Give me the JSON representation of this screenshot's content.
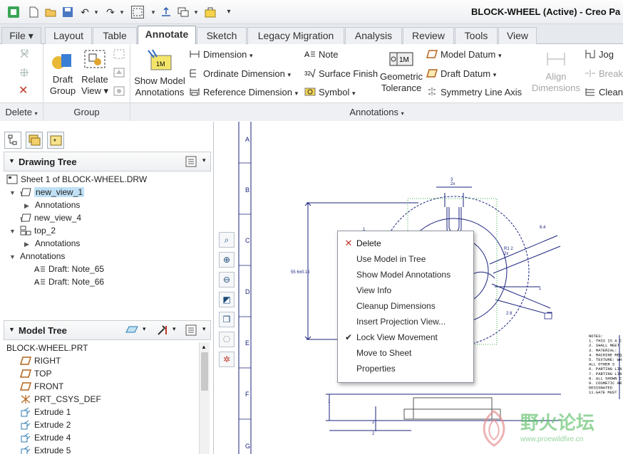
{
  "window": {
    "title": "BLOCK-WHEEL (Active) - Creo Pa"
  },
  "quick_access": [
    {
      "name": "app-logo-icon"
    },
    {
      "name": "new-icon"
    },
    {
      "name": "open-icon"
    },
    {
      "name": "save-icon"
    },
    {
      "name": "undo-icon"
    },
    {
      "name": "redo-icon"
    },
    {
      "name": "select-box-icon"
    },
    {
      "name": "regenerate-icon"
    },
    {
      "name": "windows-icon"
    },
    {
      "name": "close-window-icon"
    },
    {
      "name": "customize-icon"
    }
  ],
  "tabs": [
    "File",
    "Layout",
    "Table",
    "Annotate",
    "Sketch",
    "Legacy Migration",
    "Analysis",
    "Review",
    "Tools",
    "View"
  ],
  "active_tab": "Annotate",
  "ribbon": {
    "delete_group": "Delete",
    "group_group": "Group",
    "annotations_group": "Annotations",
    "draft_group_l1": "Draft",
    "draft_group_l2": "Group",
    "relate_view_l1": "Relate",
    "relate_view_l2": "View",
    "show_model_l1": "Show Model",
    "show_model_l2": "Annotations",
    "dimension": "Dimension",
    "ordinate_dimension": "Ordinate Dimension",
    "reference_dimension": "Reference Dimension",
    "note": "Note",
    "surface_finish": "Surface Finish",
    "symbol": "Symbol",
    "geometric_l1": "Geometric",
    "geometric_l2": "Tolerance",
    "model_datum": "Model Datum",
    "draft_datum": "Draft Datum",
    "symmetry_line_axis": "Symmetry Line Axis",
    "align_l1": "Align",
    "align_l2": "Dimensions",
    "jog": "Jog",
    "break": "Break",
    "clean": "Clean"
  },
  "drawing_tree": {
    "title": "Drawing Tree",
    "items": [
      {
        "label": "Sheet 1 of BLOCK-WHEEL.DRW"
      },
      {
        "label": "new_view_1"
      },
      {
        "label": "Annotations"
      },
      {
        "label": "new_view_4"
      },
      {
        "label": "top_2"
      },
      {
        "label": "Annotations"
      },
      {
        "label": "Annotations"
      },
      {
        "label": "Draft: Note_65"
      },
      {
        "label": "Draft: Note_66"
      }
    ]
  },
  "model_tree": {
    "title": "Model Tree",
    "items": [
      {
        "label": "BLOCK-WHEEL.PRT"
      },
      {
        "label": "RIGHT"
      },
      {
        "label": "TOP"
      },
      {
        "label": "FRONT"
      },
      {
        "label": "PRT_CSYS_DEF"
      },
      {
        "label": "Extrude 1"
      },
      {
        "label": "Extrude 2"
      },
      {
        "label": "Extrude 4"
      },
      {
        "label": "Extrude 5"
      }
    ]
  },
  "ruler_letters": [
    "A",
    "B",
    "C",
    "D",
    "E",
    "F",
    "G"
  ],
  "context_menu": [
    {
      "label": "Delete",
      "icon": "delete-x-icon"
    },
    {
      "label": "Use Model in Tree"
    },
    {
      "label": "Show Model Annotations"
    },
    {
      "label": "View Info"
    },
    {
      "label": "Cleanup Dimensions"
    },
    {
      "label": "Insert Projection View..."
    },
    {
      "label": "Lock View Movement",
      "checked": true
    },
    {
      "label": "Move to Sheet"
    },
    {
      "label": "Properties"
    }
  ],
  "drawing": {
    "dim_top": "3",
    "dim_top_sub": "2x",
    "dim_left": "55 6±0.15",
    "dim_right_1": "6.4",
    "dim_r": "R1 2",
    "dim_r_sub": "2x",
    "dim_right_2": "2 8",
    "dim_right_3": "1",
    "dim_small": "1",
    "bubble": "1",
    "notes": [
      "NOTES:",
      "1. THIS IS A C",
      "2. SHALL MEET",
      "3. MATERIAL:",
      "4. MACHINE REQ",
      "5. TEXTURE: WH",
      "   ALL OTHER S",
      "6. PARTING LIN",
      "7. PARTING LIN",
      "8. ALL SHOWN C",
      "9. COSMETIC AR",
      "   DESIGNATED",
      "11.GATE MUST"
    ]
  },
  "watermark": {
    "text": "野火论坛",
    "url": "www.proewildfire.cn"
  },
  "colors": {
    "accent": "#1f4fb0",
    "menu_delete": "#c0392b",
    "drawing_line": "#1a237e"
  }
}
